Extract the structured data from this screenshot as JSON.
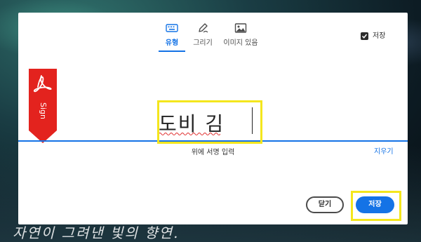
{
  "background": {
    "caption": "자연이 그려낸 빛의 향연."
  },
  "tabs": [
    {
      "label": "유형",
      "icon": "keyboard-icon",
      "active": true
    },
    {
      "label": "그리기",
      "icon": "pen-draw-icon",
      "active": false
    },
    {
      "label": "이미지 있음",
      "icon": "image-icon",
      "active": false
    }
  ],
  "save_signature": {
    "label": "저장",
    "checked": true
  },
  "ribbon": {
    "label": "Sign",
    "icon": "acrobat-logo-icon"
  },
  "signature": {
    "value": "도비 김"
  },
  "hint": "위에 서명 입력",
  "clear_label": "지우기",
  "buttons": {
    "close": "닫기",
    "save": "저장"
  },
  "colors": {
    "accent": "#1473e6",
    "ribbon": "#e3231e",
    "highlight": "#f4e61d"
  }
}
